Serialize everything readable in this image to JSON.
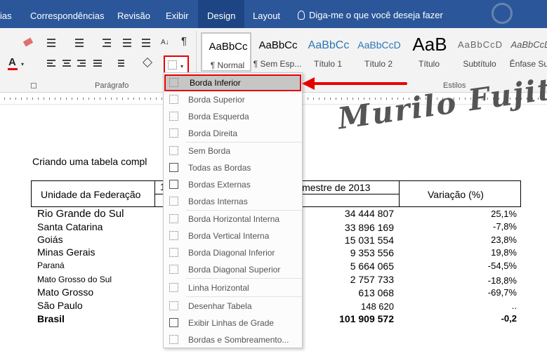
{
  "tabs": [
    "ias",
    "Correspondências",
    "Revisão",
    "Exibir",
    "Design",
    "Layout"
  ],
  "tell_me": "Diga-me o que você deseja fazer",
  "groups": {
    "paragraph": "Parágrafo",
    "styles": "Estilos"
  },
  "styles": [
    {
      "sample": "AaBbCc",
      "name": "¶ Normal"
    },
    {
      "sample": "AaBbCc",
      "name": "¶ Sem Esp..."
    },
    {
      "sample": "AaBbCc",
      "name": "Título 1"
    },
    {
      "sample": "AaBbCcD",
      "name": "Título 2"
    },
    {
      "sample": "AaB",
      "name": "Título"
    },
    {
      "sample": "AaBbCcD",
      "name": "Subtítulo"
    },
    {
      "sample": "AaBbCcD",
      "name": "Ênfase Sut"
    }
  ],
  "menu": [
    {
      "label": "Borda Inferior",
      "icon": "border-bottom-icon"
    },
    {
      "label": "Borda Superior",
      "icon": "border-top-icon"
    },
    {
      "label": "Borda Esquerda",
      "icon": "border-left-icon"
    },
    {
      "label": "Borda Direita",
      "icon": "border-right-icon"
    },
    {
      "label": "Sem Borda",
      "icon": "no-border-icon"
    },
    {
      "label": "Todas as Bordas",
      "icon": "all-borders-icon"
    },
    {
      "label": "Bordas Externas",
      "icon": "outside-borders-icon"
    },
    {
      "label": "Bordas Internas",
      "icon": "inside-borders-icon"
    },
    {
      "label": "Borda Horizontal Interna",
      "icon": "inside-horizontal-border-icon"
    },
    {
      "label": "Borda Vertical Interna",
      "icon": "inside-vertical-border-icon"
    },
    {
      "label": "Borda Diagonal Inferior",
      "icon": "diagonal-down-border-icon"
    },
    {
      "label": "Borda Diagonal Superior",
      "icon": "diagonal-up-border-icon"
    },
    {
      "label": "Linha Horizontal",
      "icon": "horizontal-line-icon"
    },
    {
      "label": "Desenhar Tabela",
      "icon": "draw-table-icon"
    },
    {
      "label": "Exibir Linhas de Grade",
      "icon": "view-gridlines-icon"
    },
    {
      "label": "Bordas e Sombreamento...",
      "icon": "borders-shading-icon"
    }
  ],
  "document": {
    "watermark": "Murilo Fujita",
    "heading": "Criando uma tabela compl",
    "header_state": "Unidade da Federação",
    "header_period_left": "1",
    "header_period": "imestre de 2013",
    "header_variation": "Variação (%)",
    "rows": [
      {
        "state": "Rio Grande do Sul",
        "value": "34 444 807",
        "variation": "25,1%"
      },
      {
        "state": "Santa Catarina",
        "value": "33 896 169",
        "variation": "-7,8%"
      },
      {
        "state": "Goiás",
        "value": "15 031 554",
        "variation": "23,8%"
      },
      {
        "state": "Minas Gerais",
        "value": "9 353 556",
        "variation": "19,8%"
      },
      {
        "state": "Paraná",
        "value": "5 664 065",
        "variation": "-54,5%"
      },
      {
        "state": "Mato Grosso do Sul",
        "value": "2 757 733",
        "variation": "-18,8%"
      },
      {
        "state": "Mato Grosso",
        "value": "613 068",
        "variation": "-69,7%"
      },
      {
        "state": "São Paulo",
        "value": "148 620",
        "variation": ".."
      },
      {
        "state": "Brasil",
        "value": "101 909 572",
        "variation": "-0,2"
      }
    ]
  }
}
